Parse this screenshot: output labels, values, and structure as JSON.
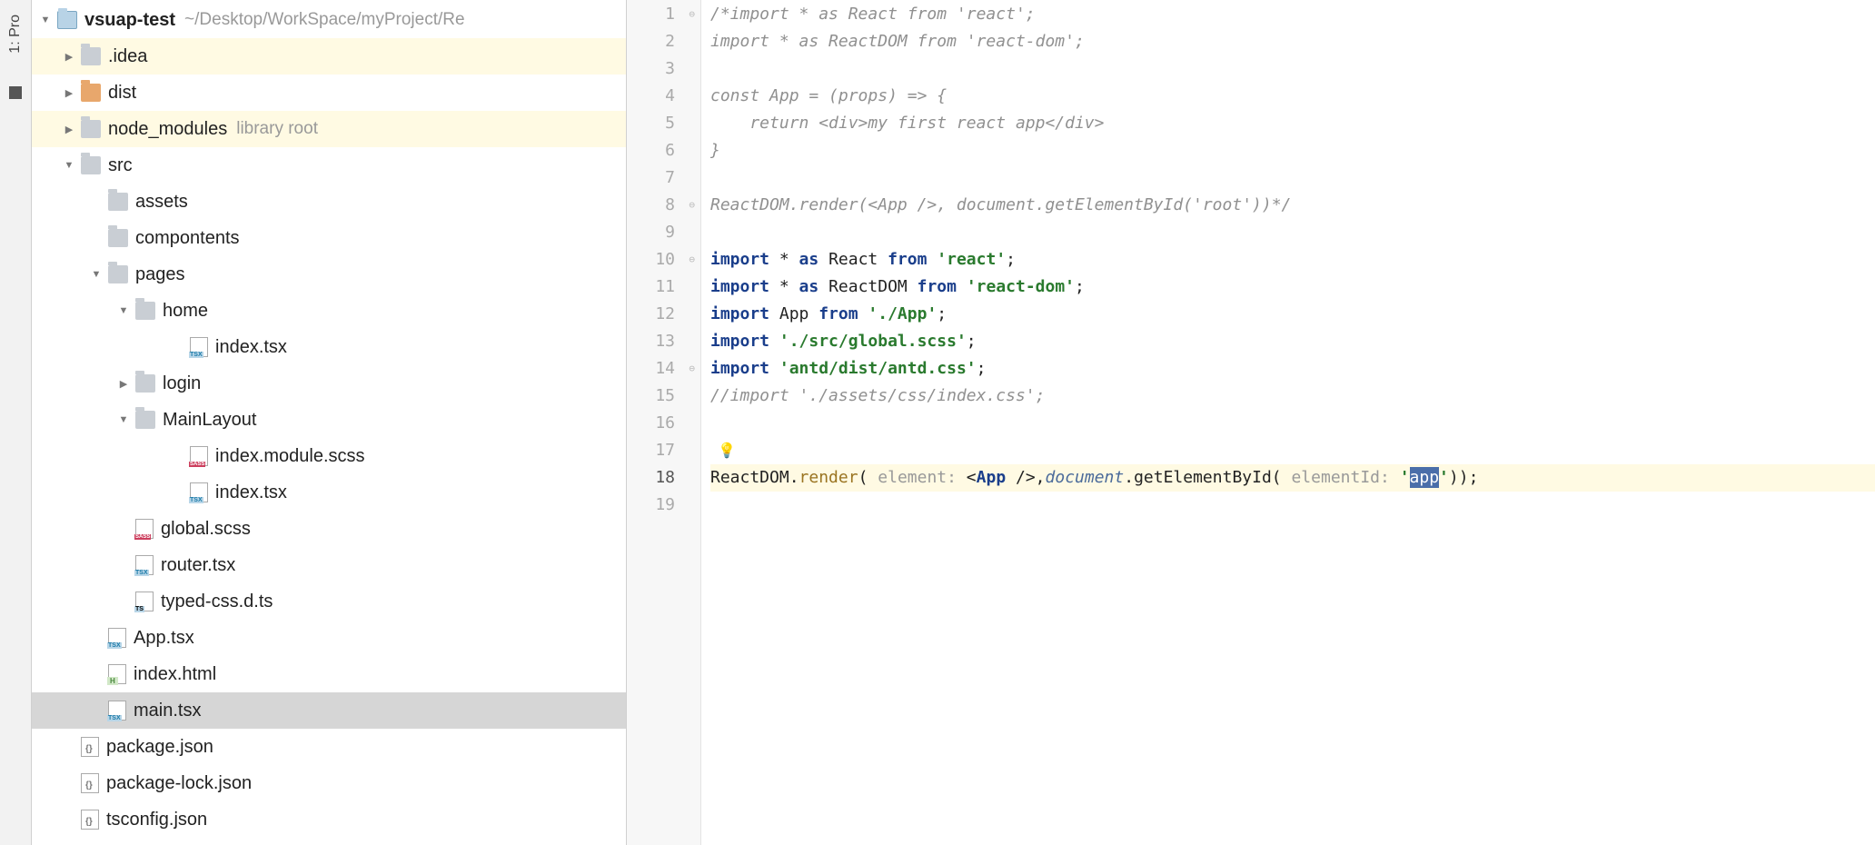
{
  "sidebar_tab": "1: Pro",
  "project": {
    "name": "vsuap-test",
    "path": "~/Desktop/WorkSpace/myProject/Re"
  },
  "tree": [
    {
      "label": "vsuap-test",
      "hint": "~/Desktop/WorkSpace/myProject/Re",
      "icon": "project",
      "indent": 0,
      "arrow": "expanded",
      "bold": true
    },
    {
      "label": ".idea",
      "icon": "folder",
      "indent": 1,
      "arrow": "collapsed",
      "highlight": "yellow"
    },
    {
      "label": "dist",
      "icon": "folder-orange",
      "indent": 1,
      "arrow": "collapsed"
    },
    {
      "label": "node_modules",
      "hint": "library root",
      "icon": "folder",
      "indent": 1,
      "arrow": "collapsed",
      "highlight": "yellow"
    },
    {
      "label": "src",
      "icon": "folder",
      "indent": 1,
      "arrow": "expanded"
    },
    {
      "label": "assets",
      "icon": "folder",
      "indent": 2,
      "arrow": "none"
    },
    {
      "label": "compontents",
      "icon": "folder",
      "indent": 2,
      "arrow": "none"
    },
    {
      "label": "pages",
      "icon": "folder",
      "indent": 2,
      "arrow": "expanded"
    },
    {
      "label": "home",
      "icon": "folder",
      "indent": 3,
      "arrow": "expanded"
    },
    {
      "label": "index.tsx",
      "icon": "tsx",
      "indent": 5,
      "arrow": "none"
    },
    {
      "label": "login",
      "icon": "folder",
      "indent": 3,
      "arrow": "collapsed"
    },
    {
      "label": "MainLayout",
      "icon": "folder",
      "indent": 3,
      "arrow": "expanded"
    },
    {
      "label": "index.module.scss",
      "icon": "sass",
      "indent": 5,
      "arrow": "none"
    },
    {
      "label": "index.tsx",
      "icon": "tsx",
      "indent": 5,
      "arrow": "none"
    },
    {
      "label": "global.scss",
      "icon": "sass",
      "indent": 3,
      "arrow": "none"
    },
    {
      "label": "router.tsx",
      "icon": "tsx",
      "indent": 3,
      "arrow": "none"
    },
    {
      "label": "typed-css.d.ts",
      "icon": "ts",
      "indent": 3,
      "arrow": "none"
    },
    {
      "label": "App.tsx",
      "icon": "tsx",
      "indent": 2,
      "arrow": "none"
    },
    {
      "label": "index.html",
      "icon": "html",
      "indent": 2,
      "arrow": "none"
    },
    {
      "label": "main.tsx",
      "icon": "tsx",
      "indent": 2,
      "arrow": "none",
      "selected": true
    },
    {
      "label": "package.json",
      "icon": "json",
      "indent": 1,
      "arrow": "none"
    },
    {
      "label": "package-lock.json",
      "icon": "json",
      "indent": 1,
      "arrow": "none"
    },
    {
      "label": "tsconfig.json",
      "icon": "json",
      "indent": 1,
      "arrow": "none"
    }
  ],
  "editor": {
    "current_line": 18,
    "bulb_line": 17,
    "selected_text": "app",
    "hints": {
      "element": "element:",
      "elementId": "elementId:"
    },
    "lines": [
      {
        "n": 1,
        "fold": "open",
        "t": [
          {
            "c": "comment",
            "v": "/*import * as React from 'react';"
          }
        ]
      },
      {
        "n": 2,
        "t": [
          {
            "c": "comment",
            "v": "import * as ReactDOM from 'react-dom';"
          }
        ]
      },
      {
        "n": 3,
        "t": [
          {
            "c": "comment",
            "v": ""
          }
        ]
      },
      {
        "n": 4,
        "t": [
          {
            "c": "comment",
            "v": "const App = (props) => {"
          }
        ]
      },
      {
        "n": 5,
        "t": [
          {
            "c": "comment",
            "v": "    return <div>my first react app</div>"
          }
        ]
      },
      {
        "n": 6,
        "t": [
          {
            "c": "comment",
            "v": "}"
          }
        ]
      },
      {
        "n": 7,
        "t": [
          {
            "c": "comment",
            "v": ""
          }
        ]
      },
      {
        "n": 8,
        "fold": "close",
        "t": [
          {
            "c": "comment",
            "v": "ReactDOM.render(<App />, document.getElementById('root'))*/"
          }
        ]
      },
      {
        "n": 9,
        "t": []
      },
      {
        "n": 10,
        "fold": "open",
        "t": [
          {
            "c": "kw",
            "v": "import"
          },
          {
            "c": "plain",
            "v": " * "
          },
          {
            "c": "kw",
            "v": "as"
          },
          {
            "c": "plain",
            "v": " React "
          },
          {
            "c": "kw",
            "v": "from"
          },
          {
            "c": "plain",
            "v": " "
          },
          {
            "c": "str",
            "v": "'react'"
          },
          {
            "c": "plain",
            "v": ";"
          }
        ]
      },
      {
        "n": 11,
        "t": [
          {
            "c": "kw",
            "v": "import"
          },
          {
            "c": "plain",
            "v": " * "
          },
          {
            "c": "kw",
            "v": "as"
          },
          {
            "c": "plain",
            "v": " ReactDOM "
          },
          {
            "c": "kw",
            "v": "from"
          },
          {
            "c": "plain",
            "v": " "
          },
          {
            "c": "str",
            "v": "'react-dom'"
          },
          {
            "c": "plain",
            "v": ";"
          }
        ]
      },
      {
        "n": 12,
        "t": [
          {
            "c": "kw",
            "v": "import"
          },
          {
            "c": "plain",
            "v": " App "
          },
          {
            "c": "kw",
            "v": "from"
          },
          {
            "c": "plain",
            "v": " "
          },
          {
            "c": "str",
            "v": "'./App'"
          },
          {
            "c": "plain",
            "v": ";"
          }
        ]
      },
      {
        "n": 13,
        "t": [
          {
            "c": "kw",
            "v": "import"
          },
          {
            "c": "plain",
            "v": " "
          },
          {
            "c": "str",
            "v": "'./src/global.scss'"
          },
          {
            "c": "plain",
            "v": ";"
          }
        ]
      },
      {
        "n": 14,
        "fold": "close",
        "t": [
          {
            "c": "kw",
            "v": "import"
          },
          {
            "c": "plain",
            "v": " "
          },
          {
            "c": "str",
            "v": "'antd/dist/antd.css'"
          },
          {
            "c": "plain",
            "v": ";"
          }
        ]
      },
      {
        "n": 15,
        "t": [
          {
            "c": "comment",
            "v": "//import './assets/css/index.css';"
          }
        ]
      },
      {
        "n": 16,
        "t": []
      },
      {
        "n": 17,
        "t": []
      },
      {
        "n": 18,
        "t": [
          {
            "c": "plain",
            "v": "ReactDOM."
          },
          {
            "c": "method",
            "v": "render"
          },
          {
            "c": "plain",
            "v": "( "
          },
          {
            "c": "hint",
            "v": "element:"
          },
          {
            "c": "plain",
            "v": " <"
          },
          {
            "c": "kw",
            "v": "App"
          },
          {
            "c": "plain",
            "v": " />,"
          },
          {
            "c": "doc",
            "v": "document"
          },
          {
            "c": "plain",
            "v": ".getElementById( "
          },
          {
            "c": "hint",
            "v": "elementId:"
          },
          {
            "c": "plain",
            "v": " "
          },
          {
            "c": "str",
            "v": "'"
          },
          {
            "c": "sel",
            "v": "app"
          },
          {
            "c": "str",
            "v": "'"
          },
          {
            "c": "plain",
            "v": "));"
          }
        ]
      },
      {
        "n": 19,
        "t": []
      }
    ]
  }
}
